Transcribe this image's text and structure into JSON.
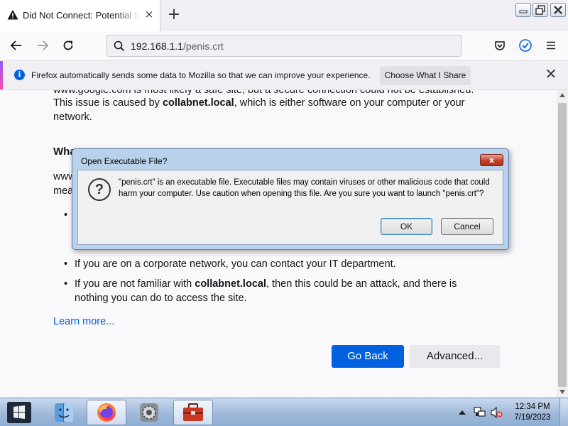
{
  "browser": {
    "tab": {
      "title": "Did Not Connect: Potential Security Issue",
      "close": "×"
    },
    "new_tab_label": "+",
    "url": {
      "host": "192.168.1.1",
      "path": "/penis.crt"
    }
  },
  "notification": {
    "message": "Firefox automatically sends some data to Mozilla so that we can improve your experience.",
    "button": "Choose What I Share",
    "close": "✕"
  },
  "page": {
    "partial_line_top": "www.google.com is most likely a safe site, but a secure connection could not be established.",
    "issue_prefix": "This issue is caused by ",
    "issue_host": "collabnet.local",
    "issue_suffix": ", which is either software on your computer or your network.",
    "what_heading_partial": "Wha",
    "partial_www": "www",
    "partial_mea": "mea",
    "bullets": [
      {
        "text": "If you are on a corporate network, you can contact your IT department."
      },
      {
        "prefix": "If you are not familiar with ",
        "host": "collabnet.local",
        "suffix": ", then this could be an attack, and there is nothing you can do to access the site."
      }
    ],
    "learn_more": "Learn more...",
    "go_back": "Go Back",
    "advanced": "Advanced..."
  },
  "dialog": {
    "title": "Open Executable File?",
    "close": "x",
    "message": "\"penis.crt\" is an executable file. Executable files may contain viruses or other malicious code that could harm your computer. Use caution when opening this file. Are you sure you want to launch \"penis.crt\"?",
    "ok": "OK",
    "cancel": "Cancel",
    "icon": "question-icon"
  },
  "taskbar": {
    "items": [
      "finder-icon",
      "firefox-icon",
      "system-settings-icon",
      "toolbox-icon"
    ],
    "active_item": "firefox-icon",
    "clock": {
      "time": "12:34 PM",
      "date": "7/19/2023"
    }
  },
  "colors": {
    "primary_button": "#0061e0",
    "link": "#0060df",
    "dialog_frame": "#b9d1ea",
    "taskbar": "#9db7d8"
  }
}
